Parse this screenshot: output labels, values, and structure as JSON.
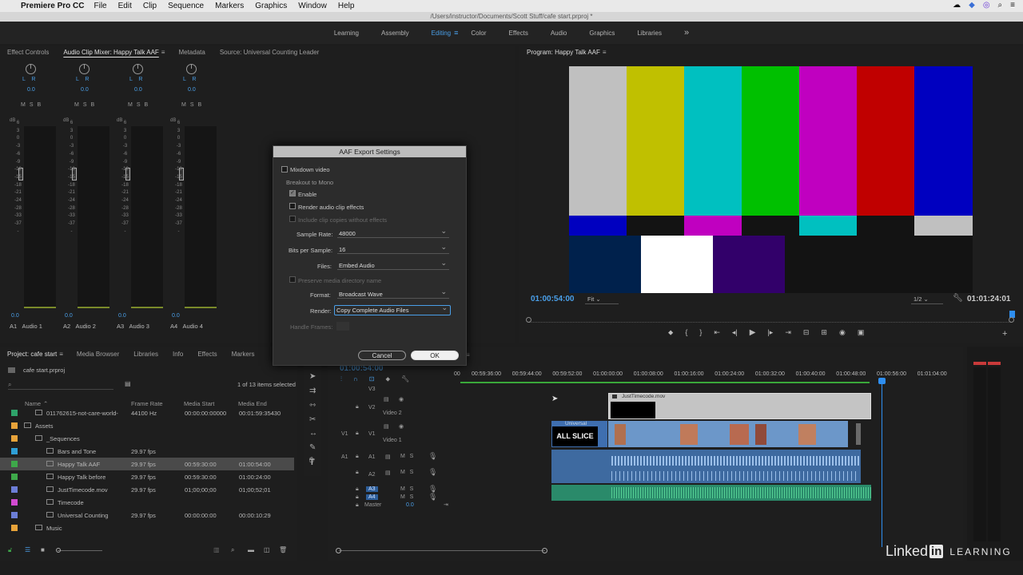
{
  "menu_bar": {
    "apple": "",
    "app_name": "Premiere Pro CC",
    "items": [
      "File",
      "Edit",
      "Clip",
      "Sequence",
      "Markers",
      "Graphics",
      "Window",
      "Help"
    ],
    "status_icons": [
      "creative-cloud-icon",
      "dropbox-icon",
      "app-icon",
      "search-icon",
      "menu-icon"
    ]
  },
  "window_title": "/Users/instructor/Documents/Scott Stuff/cafe start.prproj *",
  "workspaces": {
    "items": [
      "Learning",
      "Assembly",
      "Editing",
      "Color",
      "Effects",
      "Audio",
      "Graphics",
      "Libraries"
    ],
    "active": "Editing",
    "more": "»"
  },
  "source_panel": {
    "tabs": [
      "Effect Controls",
      "Audio Clip Mixer: Happy Talk AAF",
      "Metadata",
      "Source: Universal Counting Leader"
    ],
    "active_tab": "Audio Clip Mixer: Happy Talk AAF",
    "channels": [
      {
        "id": "A1",
        "name": "Audio 1",
        "pan": "0.0",
        "level": "0.0"
      },
      {
        "id": "A2",
        "name": "Audio 2",
        "pan": "0.0",
        "level": "0.0"
      },
      {
        "id": "A3",
        "name": "Audio 3",
        "pan": "0.0",
        "level": "0.0"
      },
      {
        "id": "A4",
        "name": "Audio 4",
        "pan": "0.0",
        "level": "0.0"
      }
    ],
    "lr": "L    R",
    "msb": "MSB",
    "db_label": "dB",
    "scale": [
      "6",
      "3",
      "0",
      "-3",
      "-6",
      "-9",
      "-13",
      "-15",
      "-18",
      "-21",
      "-24",
      "-28",
      "-33",
      "-37",
      "-",
      ""
    ]
  },
  "program_panel": {
    "title": "Program: Happy Talk AAF",
    "timecode": "01:00:54:00",
    "fit": "Fit",
    "resolution": "1/2",
    "duration": "01:01:24:01"
  },
  "dialog": {
    "title": "AAF Export Settings",
    "mixdown_video": "Mixdown video",
    "breakout_label": "Breakout to Mono",
    "enable": "Enable",
    "render_audio_effects": "Render audio clip effects",
    "include_clip_copies": "Include clip copies without effects",
    "sample_rate_label": "Sample Rate:",
    "sample_rate": "48000",
    "bits_label": "Bits per Sample:",
    "bits": "16",
    "files_label": "Files:",
    "files": "Embed Audio",
    "preserve_label": "Preserve media directory name",
    "format_label": "Format:",
    "format": "Broadcast Wave",
    "render_label": "Render:",
    "render": "Copy Complete Audio Files",
    "handle_label": "Handle Frames:",
    "cancel": "Cancel",
    "ok": "OK"
  },
  "project_panel": {
    "tabs": [
      "Project: cafe start",
      "Media Browser",
      "Libraries",
      "Info",
      "Effects",
      "Markers"
    ],
    "active_tab": "Project: cafe start",
    "project_file": "cafe start.prproj",
    "selection_status": "1 of 13 items selected",
    "columns": [
      "Name",
      "Frame Rate",
      "Media Start",
      "Media End"
    ],
    "rows": [
      {
        "name": "011762615-not-care-world-",
        "rate": "44100 Hz",
        "start": "00:00:00:00000",
        "end": "00:01:59:35430",
        "color": "#2ea36a",
        "icon": "audio-file-icon",
        "indent": 2
      },
      {
        "name": "Assets",
        "rate": "",
        "start": "",
        "end": "",
        "color": "#e8a33a",
        "icon": "folder-icon",
        "indent": 1
      },
      {
        "name": "_Sequences",
        "rate": "",
        "start": "",
        "end": "",
        "color": "#e8a33a",
        "icon": "folder-icon",
        "indent": 2
      },
      {
        "name": "Bars and Tone",
        "rate": "29.97 fps",
        "start": "",
        "end": "",
        "color": "#2e9ed6",
        "icon": "bars-icon",
        "indent": 3
      },
      {
        "name": "Happy Talk AAF",
        "rate": "29.97 fps",
        "start": "00:59:30:00",
        "end": "01:00:54:00",
        "color": "#3ea84a",
        "icon": "sequence-icon",
        "indent": 3
      },
      {
        "name": "Happy Talk before",
        "rate": "29.97 fps",
        "start": "00:59:30:00",
        "end": "01:00:24:00",
        "color": "#3ea84a",
        "icon": "sequence-icon",
        "indent": 3
      },
      {
        "name": "JustTimecode.mov",
        "rate": "29.97 fps",
        "start": "01;00;00;00",
        "end": "01;00;52;01",
        "color": "#6c7ed6",
        "icon": "video-file-icon",
        "indent": 3
      },
      {
        "name": "Timecode",
        "rate": "",
        "start": "",
        "end": "",
        "color": "#d24ad1",
        "icon": "timecode-icon",
        "indent": 3
      },
      {
        "name": "Universal Counting",
        "rate": "29.97 fps",
        "start": "00:00:00:00",
        "end": "00:00:10:29",
        "color": "#6c7ed6",
        "icon": "leader-icon",
        "indent": 3
      },
      {
        "name": "Music",
        "rate": "",
        "start": "",
        "end": "",
        "color": "#e8a33a",
        "icon": "folder-icon",
        "indent": 2
      }
    ]
  },
  "timeline": {
    "timecode": "01:00:54:00",
    "ruler": [
      "00:59:36:00",
      "00:59:44:00",
      "00:59:52:00",
      "01:00:00:00",
      "01:00:08:00",
      "01:00:16:00",
      "01:00:24:00",
      "01:00:32:00",
      "01:00:40:00",
      "01:00:48:00",
      "01:00:56:00",
      "01:01:04:00"
    ],
    "ruler_left": "00",
    "tracks": {
      "v3": "V3",
      "v2": "V2",
      "v2_name": "Video 2",
      "v1": "V1",
      "v1_name": "Video 1",
      "a1": "A1",
      "a2": "A2",
      "a3": "A3",
      "a4": "A4",
      "master": "Master",
      "master_val": "0.0"
    },
    "clip_timecode": "JustTimecode.mov",
    "clip_leader": "Universal Counting",
    "clip_slate": "ALL SLICE",
    "msb": "M   S"
  },
  "watermark": {
    "linked": "Linked",
    "in": "in",
    "learning": "LEARNING"
  }
}
